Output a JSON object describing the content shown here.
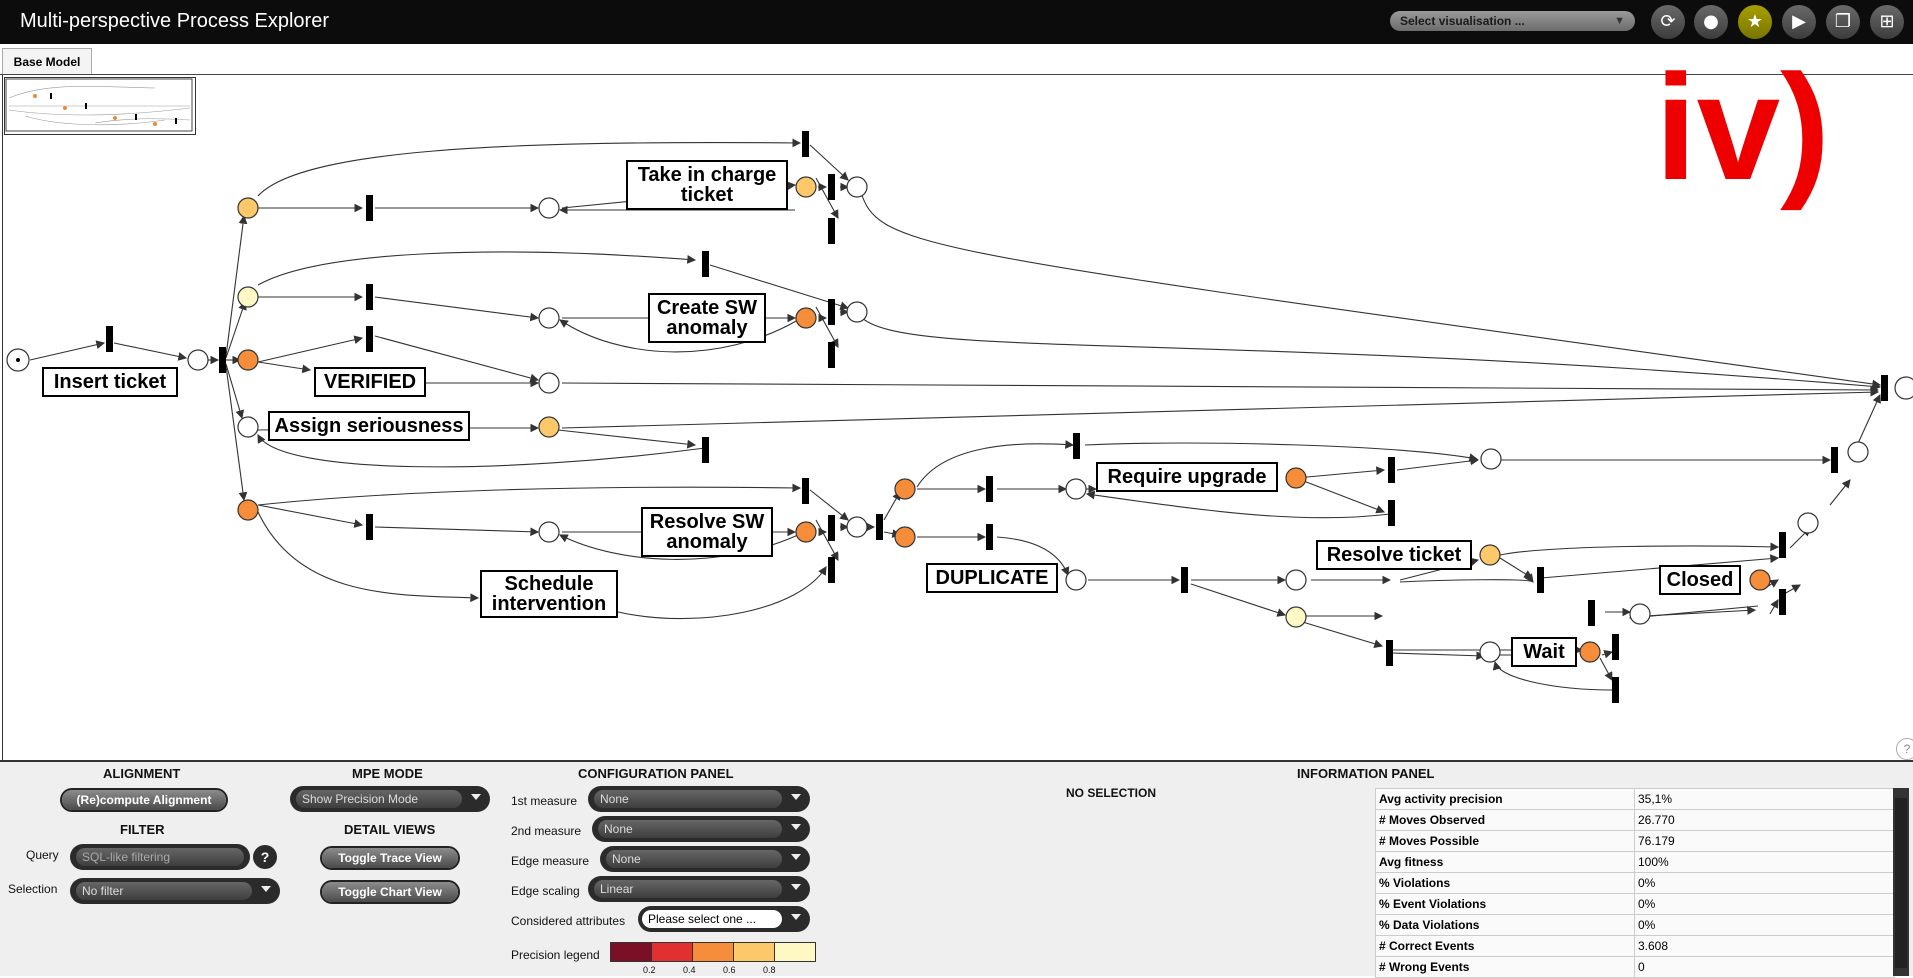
{
  "app": {
    "title": "Multi-perspective Process Explorer"
  },
  "toolbar": {
    "vis_select": "Select visualisation ...",
    "buttons": [
      {
        "icon": "refresh-icon",
        "glyph": "⟳"
      },
      {
        "icon": "drop-icon",
        "glyph": "💧"
      },
      {
        "icon": "star-icon",
        "glyph": "★"
      },
      {
        "icon": "play-icon",
        "glyph": "▶"
      },
      {
        "icon": "copy-icon",
        "glyph": "❐"
      },
      {
        "icon": "grid-icon",
        "glyph": "⊞"
      }
    ]
  },
  "tabs": [
    {
      "label": "Base Model"
    }
  ],
  "model": {
    "overlay_mark": "iv)",
    "activities": [
      {
        "label": "Insert ticket"
      },
      {
        "label": "VERIFIED"
      },
      {
        "label": "Assign seriousness"
      },
      {
        "label": "Take in charge ticket"
      },
      {
        "label": "Create SW anomaly"
      },
      {
        "label": "Resolve SW anomaly"
      },
      {
        "label": "Schedule intervention"
      },
      {
        "label": "Require upgrade"
      },
      {
        "label": "DUPLICATE"
      },
      {
        "label": "Resolve ticket"
      },
      {
        "label": "Closed"
      },
      {
        "label": "Wait"
      }
    ],
    "colors": {
      "dark_orange": "#f58d3a",
      "light_orange": "#fcc86a",
      "pale_yellow": "#fdf8c4",
      "edge": "#333333"
    }
  },
  "alignment": {
    "title": "ALIGNMENT",
    "recompute_label": "(Re)compute Alignment"
  },
  "filter": {
    "title": "FILTER",
    "query_label": "Query",
    "query_placeholder": "SQL-like filtering",
    "help": "?",
    "selection_label": "Selection",
    "selection_value": "No filter"
  },
  "mpe_mode": {
    "title": "MPE MODE",
    "value": "Show Precision Mode"
  },
  "detail_views": {
    "title": "DETAIL VIEWS",
    "trace_label": "Toggle Trace View",
    "chart_label": "Toggle Chart View"
  },
  "config": {
    "title": "CONFIGURATION PANEL",
    "first_measure_label": "1st measure",
    "first_measure_value": "None",
    "second_measure_label": "2nd measure",
    "second_measure_value": "None",
    "edge_measure_label": "Edge measure",
    "edge_measure_value": "None",
    "edge_scaling_label": "Edge scaling",
    "edge_scaling_value": "Linear",
    "attributes_label": "Considered attributes",
    "attributes_value": "Please select one ...",
    "legend_label": "Precision legend",
    "legend_colors": [
      "#7a0f25",
      "#e03030",
      "#f58d3a",
      "#fcc86a",
      "#fdf8c4"
    ],
    "legend_ticks": [
      "0.2",
      "0.4",
      "0.6",
      "0.8"
    ]
  },
  "selection": {
    "text": "NO SELECTION"
  },
  "info": {
    "title": "INFORMATION PANEL",
    "rows": [
      {
        "key": "Avg activity precision",
        "value": "35,1%"
      },
      {
        "key": "# Moves Observed",
        "value": "26.770"
      },
      {
        "key": "# Moves Possible",
        "value": "76.179"
      },
      {
        "key": "Avg fitness",
        "value": "100%"
      },
      {
        "key": "% Violations",
        "value": "0%"
      },
      {
        "key": "% Event Violations",
        "value": "0%"
      },
      {
        "key": "% Data Violations",
        "value": "0%"
      },
      {
        "key": "# Correct Events",
        "value": "3.608"
      },
      {
        "key": "# Wrong Events",
        "value": "0"
      }
    ]
  },
  "side_help": "?"
}
